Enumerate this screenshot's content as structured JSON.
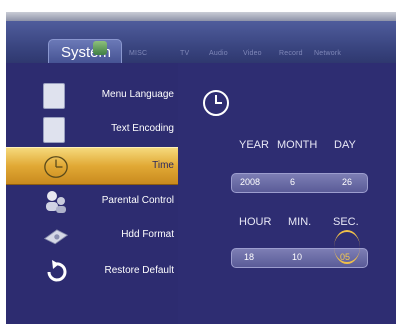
{
  "header": {
    "active_tab": "System",
    "other_tabs": [
      "MISC",
      "TV",
      "Audio",
      "Video",
      "Record",
      "Network"
    ]
  },
  "menu": {
    "items": [
      {
        "label": "Menu Language",
        "icon": "book-icon"
      },
      {
        "label": "Text Encoding",
        "icon": "document-icon"
      },
      {
        "label": "Time",
        "icon": "clock-icon",
        "selected": true
      },
      {
        "label": "Parental Control",
        "icon": "people-icon"
      },
      {
        "label": "Hdd Format",
        "icon": "hard-drive-icon"
      },
      {
        "label": "Restore Default",
        "icon": "restore-icon"
      }
    ]
  },
  "time": {
    "date_headers": [
      "YEAR",
      "MONTH",
      "DAY"
    ],
    "date_values": [
      "2008",
      "6",
      "26"
    ],
    "time_headers": [
      "HOUR",
      "MIN.",
      "SEC."
    ],
    "time_values": [
      "18",
      "10",
      "05"
    ]
  },
  "colors": {
    "background": "#2f2e72",
    "highlight": "#e1a935",
    "selected_value": "#f6c94d"
  }
}
